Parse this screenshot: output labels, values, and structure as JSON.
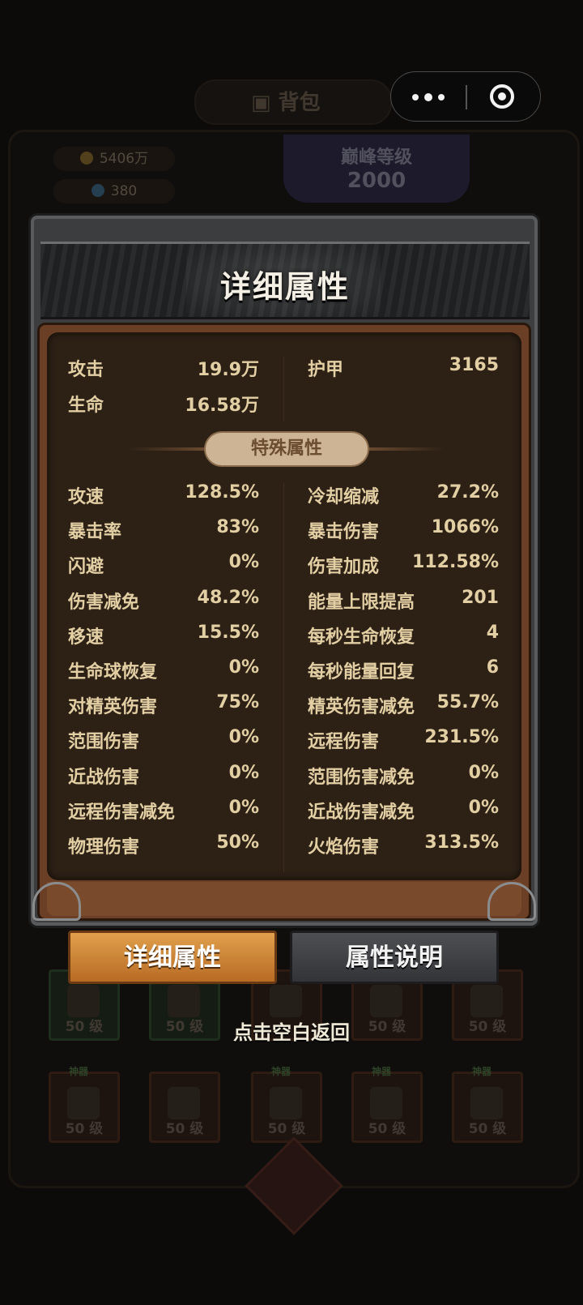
{
  "background": {
    "title": "背包",
    "gold": "5406万",
    "gems": "380",
    "rank_label": "巅峰等级",
    "rank_value": "2000",
    "lock_tag": "神器",
    "slots": [
      {
        "level": "50 级",
        "tag": ""
      },
      {
        "level": "50 级",
        "tag": ""
      },
      {
        "level": "",
        "tag": ""
      },
      {
        "level": "50 级",
        "tag": ""
      },
      {
        "level": "50 级",
        "tag": ""
      },
      {
        "level": "50 级",
        "tag": "神器"
      },
      {
        "level": "50 级",
        "tag": ""
      },
      {
        "level": "50 级",
        "tag": "神器"
      },
      {
        "level": "50 级",
        "tag": "神器"
      },
      {
        "level": "50 级",
        "tag": "神器"
      }
    ]
  },
  "capsule": {
    "menu_icon": "more-dots-icon",
    "close_icon": "target-icon"
  },
  "modal": {
    "title": "详细属性",
    "base_stats": [
      {
        "label": "攻击",
        "value": "19.9万"
      },
      {
        "label": "护甲",
        "value": "3165"
      },
      {
        "label": "生命",
        "value": "16.58万"
      }
    ],
    "section_title": "特殊属性",
    "special_stats_left": [
      {
        "label": "攻速",
        "value": "128.5%"
      },
      {
        "label": "暴击率",
        "value": "83%"
      },
      {
        "label": "闪避",
        "value": "0%"
      },
      {
        "label": "伤害减免",
        "value": "48.2%"
      },
      {
        "label": "移速",
        "value": "15.5%"
      },
      {
        "label": "生命球恢复",
        "value": "0%"
      },
      {
        "label": "对精英伤害",
        "value": "75%"
      },
      {
        "label": "范围伤害",
        "value": "0%"
      },
      {
        "label": "近战伤害",
        "value": "0%"
      },
      {
        "label": "远程伤害减免",
        "value": "0%"
      },
      {
        "label": "物理伤害",
        "value": "50%"
      }
    ],
    "special_stats_right": [
      {
        "label": "冷却缩减",
        "value": "27.2%"
      },
      {
        "label": "暴击伤害",
        "value": "1066%"
      },
      {
        "label": "伤害加成",
        "value": "112.58%"
      },
      {
        "label": "能量上限提高",
        "value": "201"
      },
      {
        "label": "每秒生命恢复",
        "value": "4"
      },
      {
        "label": "每秒能量回复",
        "value": "6"
      },
      {
        "label": "精英伤害减免",
        "value": "55.7%"
      },
      {
        "label": "远程伤害",
        "value": "231.5%"
      },
      {
        "label": "范围伤害减免",
        "value": "0%"
      },
      {
        "label": "近战伤害减免",
        "value": "0%"
      },
      {
        "label": "火焰伤害",
        "value": "313.5%"
      }
    ]
  },
  "tabs": {
    "active": "详细属性",
    "inactive": "属性说明"
  },
  "hint": "点击空白返回",
  "colors": {
    "accent": "#d98f3e",
    "stat_text": "#e3cfa4",
    "panel_bg": "#2d2116"
  }
}
